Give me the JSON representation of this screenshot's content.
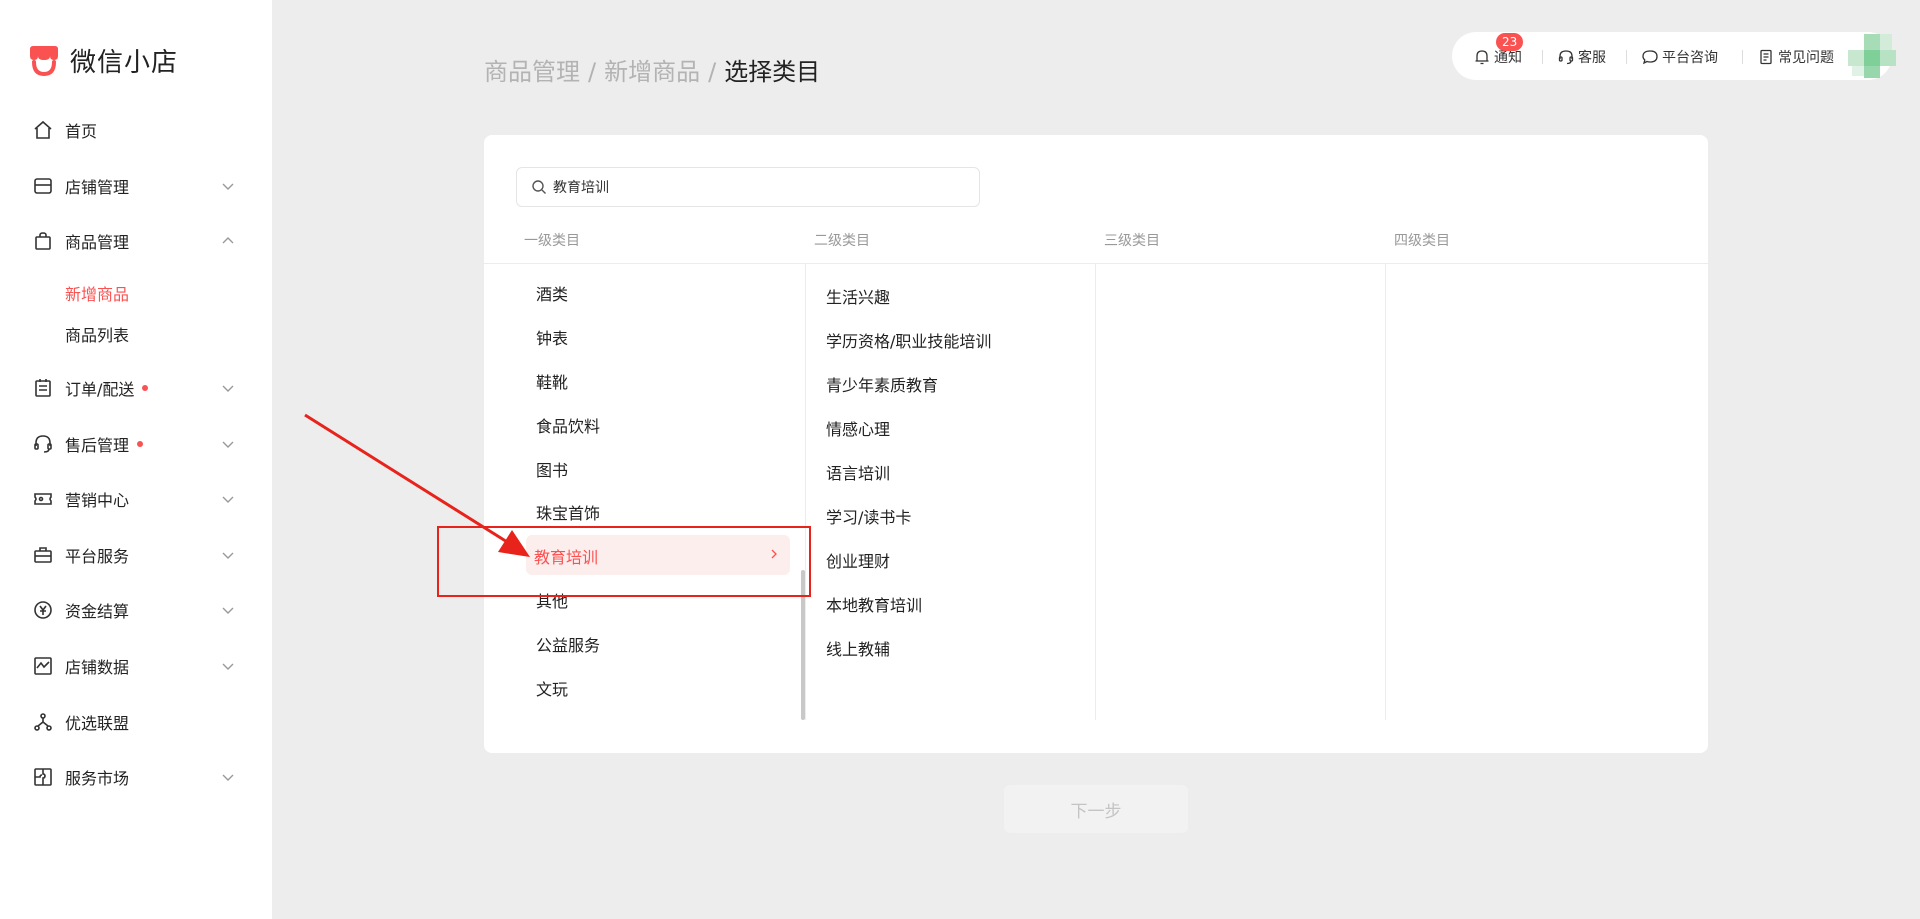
{
  "brand": {
    "name": "微信小店",
    "logo_icon": "shop-logo-icon",
    "color": "#fa5151"
  },
  "sidebar": {
    "items": [
      {
        "label": "首页",
        "icon": "home-icon",
        "expandable": false
      },
      {
        "label": "店铺管理",
        "icon": "store-icon",
        "expandable": true
      },
      {
        "label": "商品管理",
        "icon": "bag-icon",
        "expandable": true,
        "expanded": true,
        "children": [
          {
            "label": "新增商品",
            "active": true
          },
          {
            "label": "商品列表",
            "active": false
          }
        ]
      },
      {
        "label": "订单/配送",
        "icon": "order-icon",
        "expandable": true,
        "dot": true
      },
      {
        "label": "售后管理",
        "icon": "headset-icon",
        "expandable": true,
        "dot": true
      },
      {
        "label": "营销中心",
        "icon": "ticket-icon",
        "expandable": true
      },
      {
        "label": "平台服务",
        "icon": "briefcase-icon",
        "expandable": true
      },
      {
        "label": "资金结算",
        "icon": "yuan-icon",
        "expandable": true
      },
      {
        "label": "店铺数据",
        "icon": "chart-icon",
        "expandable": true
      },
      {
        "label": "优选联盟",
        "icon": "network-icon",
        "expandable": false
      },
      {
        "label": "服务市场",
        "icon": "puzzle-icon",
        "expandable": true
      }
    ]
  },
  "breadcrumb": {
    "items": [
      "商品管理",
      "新增商品",
      "选择类目"
    ],
    "separator": "/"
  },
  "topbar": {
    "notify_label": "通知",
    "notify_count": "23",
    "service_label": "客服",
    "consult_label": "平台咨询",
    "faq_label": "常见问题"
  },
  "search": {
    "value": "教育培训",
    "placeholder": ""
  },
  "columns": {
    "level1": {
      "header": "一级类目",
      "items": [
        "酒类",
        "钟表",
        "鞋靴",
        "食品饮料",
        "图书",
        "珠宝首饰",
        "教育培训",
        "其他",
        "公益服务",
        "文玩"
      ],
      "selected": "教育培训"
    },
    "level2": {
      "header": "二级类目",
      "items": [
        "生活兴趣",
        "学历资格/职业技能培训",
        "青少年素质教育",
        "情感心理",
        "语言培训",
        "学习/读书卡",
        "创业理财",
        "本地教育培训",
        "线上教辅"
      ]
    },
    "level3": {
      "header": "三级类目",
      "items": []
    },
    "level4": {
      "header": "四级类目",
      "items": []
    }
  },
  "next_button": {
    "label": "下一步",
    "disabled": true
  },
  "colors": {
    "accent": "#fa5151",
    "annotation": "#e8231b",
    "background": "#ededed"
  }
}
